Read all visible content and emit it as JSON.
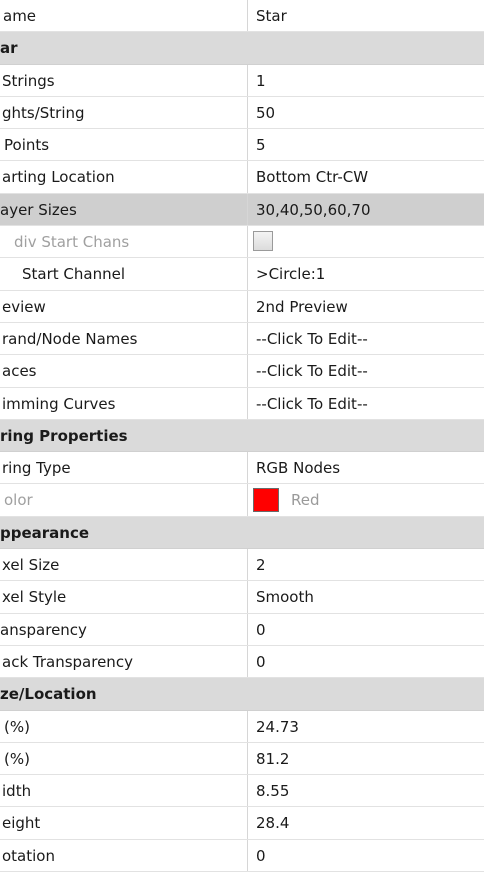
{
  "rows": [
    {
      "type": "prop",
      "name": "ame",
      "value": "Star"
    },
    {
      "type": "cat",
      "name": "ar"
    },
    {
      "type": "prop",
      "name": "Strings",
      "value": "1"
    },
    {
      "type": "prop",
      "name": "ghts/String",
      "value": "50"
    },
    {
      "type": "prop",
      "name": "Points",
      "value": "5"
    },
    {
      "type": "prop",
      "name": "arting Location",
      "value": "Bottom Ctr-CW"
    },
    {
      "type": "prop",
      "name": "ayer Sizes",
      "value": "30,40,50,60,70",
      "selected": true
    },
    {
      "type": "check",
      "name": "div Start Chans",
      "disabled": true,
      "checked": false
    },
    {
      "type": "prop",
      "name": "Start Channel",
      "value": ">Circle:1"
    },
    {
      "type": "prop",
      "name": "eview",
      "value": "2nd Preview"
    },
    {
      "type": "prop",
      "name": "rand/Node Names",
      "value": "--Click To Edit--"
    },
    {
      "type": "prop",
      "name": "aces",
      "value": "--Click To Edit--"
    },
    {
      "type": "prop",
      "name": "imming Curves",
      "value": "--Click To Edit--"
    },
    {
      "type": "cat",
      "name": "ring Properties"
    },
    {
      "type": "prop",
      "name": "ring Type",
      "value": "RGB Nodes"
    },
    {
      "type": "color",
      "name": "olor",
      "value": "Red",
      "color": "#ff0000",
      "disabled": true
    },
    {
      "type": "cat",
      "name": "ppearance"
    },
    {
      "type": "prop",
      "name": "xel Size",
      "value": "2"
    },
    {
      "type": "prop",
      "name": "xel Style",
      "value": "Smooth"
    },
    {
      "type": "prop",
      "name": "ansparency",
      "value": "0"
    },
    {
      "type": "prop",
      "name": "ack Transparency",
      "value": "0"
    },
    {
      "type": "cat",
      "name": "ze/Location"
    },
    {
      "type": "prop",
      "name": "(%)",
      "value": "24.73"
    },
    {
      "type": "prop",
      "name": "(%)",
      "value": "81.2"
    },
    {
      "type": "prop",
      "name": "idth",
      "value": "8.55"
    },
    {
      "type": "prop",
      "name": "eight",
      "value": "28.4"
    },
    {
      "type": "prop",
      "name": "otation",
      "value": "0"
    }
  ]
}
